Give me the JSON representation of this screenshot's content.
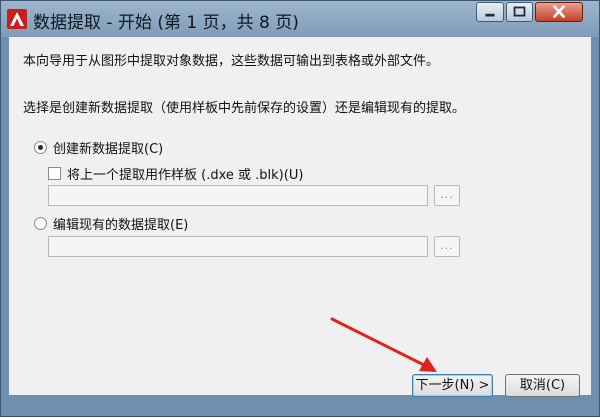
{
  "window": {
    "title": "数据提取 - 开始 (第 1 页，共 8 页)",
    "app_icon": "autocad-logo-icon",
    "controls": [
      "minimize-icon",
      "maximize-icon",
      "close-icon"
    ]
  },
  "content": {
    "intro": "本向导用于从图形中提取对象数据，这些数据可输出到表格或外部文件。",
    "question": "选择是创建新数据提取（使用样板中先前保存的设置）还是编辑现有的提取。",
    "options": {
      "create_new": {
        "label": "创建新数据提取(C)",
        "selected": true
      },
      "use_template": {
        "label": "将上一个提取用作样板  (.dxe 或 .blk)(U)",
        "checked": false,
        "path_value": "",
        "browse_label": "..."
      },
      "edit_existing": {
        "label": "编辑现有的数据提取(E)",
        "selected": false,
        "path_value": "",
        "browse_label": "..."
      }
    }
  },
  "buttons": {
    "next_label": "下一步(N) >",
    "cancel_label": "取消(C)"
  },
  "annotation": {
    "arrow_color": "#e0231b"
  },
  "colors": {
    "title_bar": "#8ba6c2",
    "close_button": "#c4402a",
    "dialog_bg": "#f0f0f0"
  }
}
